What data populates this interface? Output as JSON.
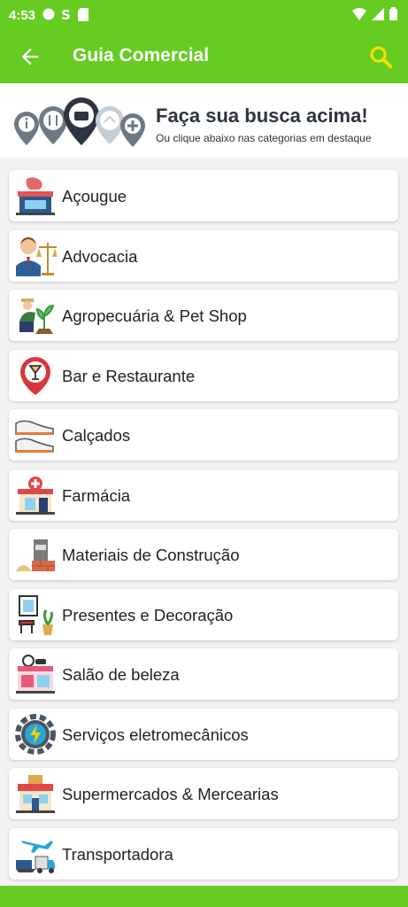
{
  "status_bar": {
    "time": "4:53"
  },
  "app_bar": {
    "title": "Guia Comercial"
  },
  "banner": {
    "headline": "Faça sua busca acima!",
    "subtitle": "Ou clique abaixo nas categorias em destaque"
  },
  "categories": [
    {
      "label": "Açougue",
      "icon": "butcher-shop-icon"
    },
    {
      "label": "Advocacia",
      "icon": "lawyer-icon"
    },
    {
      "label": "Agropecuária & Pet Shop",
      "icon": "farmer-icon"
    },
    {
      "label": "Bar e Restaurante",
      "icon": "restaurant-pin-icon"
    },
    {
      "label": "Calçados",
      "icon": "shoes-icon"
    },
    {
      "label": "Farmácia",
      "icon": "pharmacy-icon"
    },
    {
      "label": "Materiais de Construção",
      "icon": "construction-materials-icon"
    },
    {
      "label": "Presentes e Decoração",
      "icon": "decoration-icon"
    },
    {
      "label": "Salão de beleza",
      "icon": "beauty-salon-icon"
    },
    {
      "label": "Serviços eletromecânicos",
      "icon": "electromechanical-gear-icon"
    },
    {
      "label": "Supermercados & Mercearias",
      "icon": "supermarket-icon"
    },
    {
      "label": "Transportadora",
      "icon": "transport-icon"
    }
  ],
  "colors": {
    "primary": "#66cc22",
    "search_icon": "#f5e000"
  }
}
